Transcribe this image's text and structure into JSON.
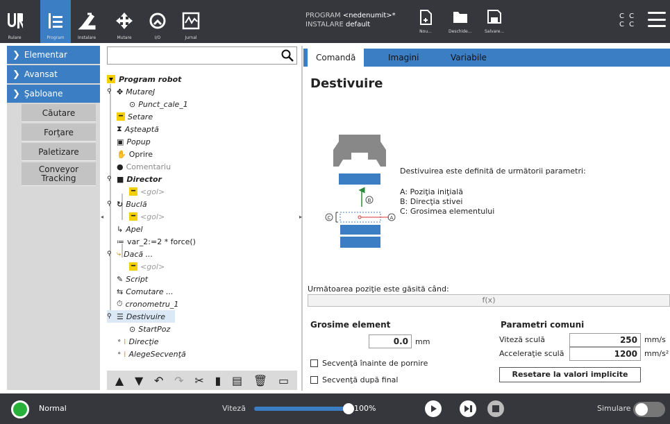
{
  "topnav": [
    {
      "label": "Rulare"
    },
    {
      "label": "Program"
    },
    {
      "label": "Instalare"
    },
    {
      "label": "Mutare"
    },
    {
      "label": "I/O"
    },
    {
      "label": "Jurnal"
    }
  ],
  "program": {
    "prog_label": "PROGRAM",
    "prog_value": "<nedenumit>*",
    "inst_label": "INSTALARE",
    "inst_value": "default"
  },
  "file": {
    "new": "Nou...",
    "open": "Deschide...",
    "save": "Salvare..."
  },
  "cc": {
    "line1": "C C",
    "line2": "C C"
  },
  "sidebar": {
    "elementar": "Elementar",
    "avansat": "Avansat",
    "sabloane": "Şabloane",
    "items": [
      "Căutare",
      "Forţare",
      "Paletizare",
      "Conveyor Tracking"
    ]
  },
  "tree": {
    "root": "Program robot",
    "n1": "MutareJ",
    "n2": "Punct_cale_1",
    "n3": "Setare",
    "n4": "Aşteaptă",
    "n5": "Popup",
    "n6": "Oprire",
    "n7": "Comentariu",
    "n8": "Director",
    "n9": "<gol>",
    "n10": "Buclă",
    "n11": "<gol>",
    "n12": "Apel",
    "n13": "var_2:=2 * force()",
    "n14": "Dacă ...",
    "n15": "<gol>",
    "n16": "Script",
    "n17": "Comutare ...",
    "n18": "cronometru_1",
    "n19": "Destivuire",
    "n20": "StartPoz",
    "n21": "Direcţie",
    "n22": "AlegeSecvenţă"
  },
  "tabs": [
    "Comandă",
    "Imagini",
    "Variabile"
  ],
  "main": {
    "title": "Destivuire",
    "desc": "Destivuirea este definită de următorii parametri:",
    "paramA": "A: Poziţia iniţială",
    "paramB": "B: Direcţia stivei",
    "paramC": "C: Grosimea elementului",
    "next_label": "Următoarea poziţie este găsită când:",
    "fx": "f(x)",
    "thickness_heading": "Grosime element",
    "thickness_value": "0.0",
    "thickness_unit": "mm",
    "seq_before": "Secvenţă înainte de pornire",
    "seq_after": "Secvenţă după final",
    "common_heading": "Parametri comuni",
    "speed_label": "Viteză sculă",
    "speed_value": "250",
    "speed_unit": "mm/s",
    "acc_label": "Acceleraţie sculă",
    "acc_value": "1200",
    "acc_unit": "mm/s²",
    "reset": "Resetare la valori implicite",
    "diag_a": "A",
    "diag_b": "B",
    "diag_c": "C"
  },
  "bottom": {
    "status": "Normal",
    "speed_label": "Viteză",
    "speed_value": "100%",
    "speed_fraction": 1.0,
    "sim": "Simulare"
  },
  "colors": {
    "accent": "#3c7ec4",
    "topbar": "#35373d",
    "status": "#27b03a"
  }
}
